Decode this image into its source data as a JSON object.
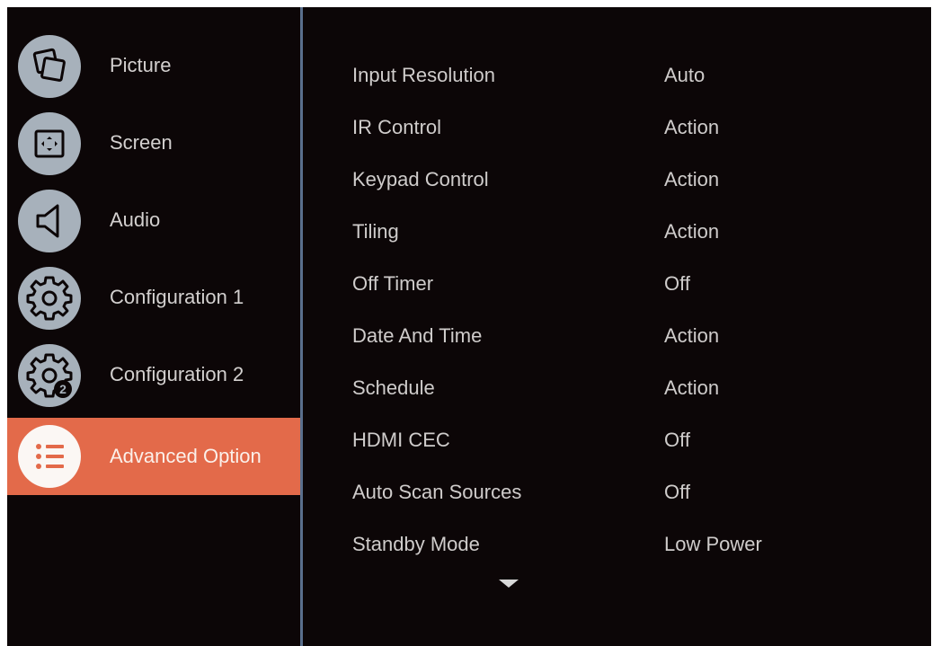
{
  "sidebar": {
    "items": [
      {
        "label": "Picture",
        "icon": "picture-icon",
        "active": false
      },
      {
        "label": "Screen",
        "icon": "screen-icon",
        "active": false
      },
      {
        "label": "Audio",
        "icon": "speaker-icon",
        "active": false
      },
      {
        "label": "Configuration 1",
        "icon": "gear-icon",
        "active": false
      },
      {
        "label": "Configuration 2",
        "icon": "gear-2-icon",
        "badge": "2",
        "active": false
      },
      {
        "label": "Advanced Option",
        "icon": "list-icon",
        "active": true
      }
    ]
  },
  "settings": {
    "rows": [
      {
        "label": "Input Resolution",
        "value": "Auto"
      },
      {
        "label": "IR Control",
        "value": "Action"
      },
      {
        "label": "Keypad Control",
        "value": "Action"
      },
      {
        "label": "Tiling",
        "value": "Action"
      },
      {
        "label": "Off Timer",
        "value": "Off"
      },
      {
        "label": "Date And Time",
        "value": "Action"
      },
      {
        "label": "Schedule",
        "value": "Action"
      },
      {
        "label": "HDMI CEC",
        "value": "Off"
      },
      {
        "label": "Auto Scan Sources",
        "value": "Off"
      },
      {
        "label": "Standby Mode",
        "value": "Low Power"
      }
    ],
    "more_indicator": "chevron-down-icon"
  },
  "colors": {
    "background": "#0c0607",
    "active_highlight": "#e36a4a",
    "icon_circle": "#a7b1bb",
    "divider": "#5a6f8c",
    "text": "#cfcccb"
  }
}
